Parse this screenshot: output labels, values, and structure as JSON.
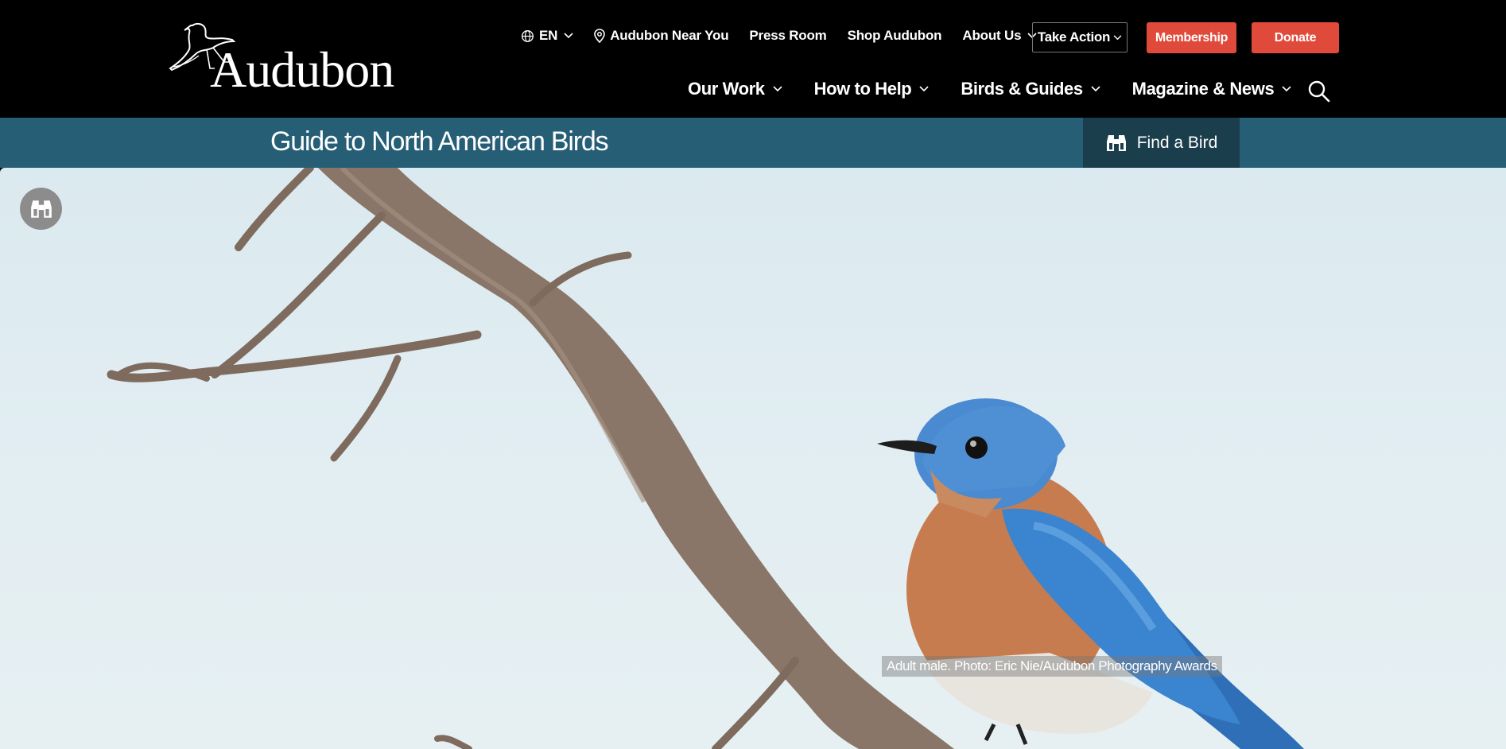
{
  "brand": {
    "logo_text": "Audubon"
  },
  "utility_nav": {
    "language": "EN",
    "near_you": "Audubon Near You",
    "press_room": "Press Room",
    "shop": "Shop Audubon",
    "about": "About Us"
  },
  "actions": {
    "take_action": "Take Action",
    "membership": "Membership",
    "donate": "Donate"
  },
  "main_nav": {
    "items": [
      {
        "label": "Our Work"
      },
      {
        "label": "How to Help"
      },
      {
        "label": "Birds & Guides"
      },
      {
        "label": "Magazine & News"
      }
    ]
  },
  "guide": {
    "title": "Guide to North American Birds",
    "find_label": "Find a Bird"
  },
  "hero": {
    "caption": "Adult male. Photo: Eric Nie/Audubon Photography Awards"
  },
  "colors": {
    "header_bg": "#000000",
    "accent_red": "#e04a3a",
    "guide_bar": "#265f75",
    "find_button": "#1b3e4d"
  },
  "icons": [
    "globe-icon",
    "location-pin-icon",
    "chevron-down-icon",
    "search-icon",
    "binoculars-icon",
    "heron-logo-icon"
  ]
}
